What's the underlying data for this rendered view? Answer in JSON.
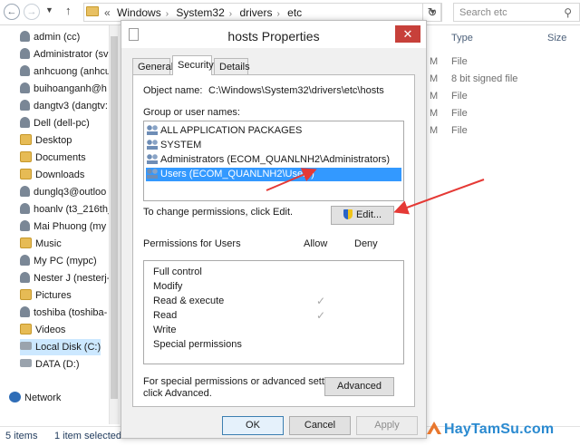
{
  "explorer": {
    "crumbs": [
      "Windows",
      "System32",
      "drivers",
      "etc"
    ],
    "search_placeholder": "Search etc",
    "columns": [
      "Type",
      "Size"
    ],
    "rows": [
      {
        "date_tail": "M",
        "type": "File"
      },
      {
        "date_tail": "M",
        "type": "8 bit signed file"
      },
      {
        "date_tail": "M",
        "type": "File"
      },
      {
        "date_tail": "M",
        "type": "File"
      },
      {
        "date_tail": "M",
        "type": "File"
      }
    ],
    "nav_items": [
      {
        "label": "admin (cc)",
        "icon": "user-icon"
      },
      {
        "label": "Administrator (sv",
        "icon": "user-icon"
      },
      {
        "label": "anhcuong (anhcu",
        "icon": "user-icon"
      },
      {
        "label": "buihoanganh@h",
        "icon": "user-icon"
      },
      {
        "label": "dangtv3 (dangtv:",
        "icon": "user-icon"
      },
      {
        "label": "Dell (dell-pc)",
        "icon": "user-icon"
      },
      {
        "label": "Desktop",
        "icon": "folder-icon"
      },
      {
        "label": "Documents",
        "icon": "folder-icon"
      },
      {
        "label": "Downloads",
        "icon": "folder-icon"
      },
      {
        "label": "dunglq3@outloo",
        "icon": "user-icon"
      },
      {
        "label": "hoanlv (t3_216th_",
        "icon": "user-icon"
      },
      {
        "label": "Mai Phuong (my",
        "icon": "user-icon"
      },
      {
        "label": "Music",
        "icon": "folder-icon"
      },
      {
        "label": "My PC (mypc)",
        "icon": "user-icon"
      },
      {
        "label": "Nester J (nesterj-",
        "icon": "user-icon"
      },
      {
        "label": "Pictures",
        "icon": "folder-icon"
      },
      {
        "label": "toshiba (toshiba-",
        "icon": "user-icon"
      },
      {
        "label": "Videos",
        "icon": "folder-icon"
      },
      {
        "label": "Local Disk (C:)",
        "icon": "disk-icon"
      },
      {
        "label": "DATA (D:)",
        "icon": "disk-icon"
      }
    ],
    "network_label": "Network",
    "status_items": "5 items",
    "status_selected": "1 item selected"
  },
  "dialog": {
    "title": "hosts Properties",
    "close_glyph": "✕",
    "tabs": [
      "General",
      "Security",
      "Details"
    ],
    "object_label": "Object name:",
    "object_value": "C:\\Windows\\System32\\drivers\\etc\\hosts",
    "group_label": "Group or user names:",
    "groups": [
      "ALL APPLICATION PACKAGES",
      "SYSTEM",
      "Administrators (ECOM_QUANLNH2\\Administrators)",
      "Users (ECOM_QUANLNH2\\Users)"
    ],
    "selected_group_index": 3,
    "change_text": "To change permissions, click Edit.",
    "edit_button": "Edit...",
    "perm_header": "Permissions for Users",
    "allow_header": "Allow",
    "deny_header": "Deny",
    "permissions": [
      {
        "name": "Full control",
        "allow": false
      },
      {
        "name": "Modify",
        "allow": false
      },
      {
        "name": "Read & execute",
        "allow": true
      },
      {
        "name": "Read",
        "allow": true
      },
      {
        "name": "Write",
        "allow": false
      },
      {
        "name": "Special permissions",
        "allow": false
      }
    ],
    "check_glyph": "✓",
    "special_text_1": "For special permissions or advanced settings,",
    "special_text_2": "click Advanced.",
    "advanced_button": "Advanced",
    "ok_button": "OK",
    "cancel_button": "Cancel",
    "apply_button": "Apply"
  },
  "watermark": "HayTamSu.com",
  "colors": {
    "selection": "#3399ff",
    "close_button": "#c7403a",
    "annotation_arrow": "#e53935",
    "watermark": "#2a8ad0"
  }
}
